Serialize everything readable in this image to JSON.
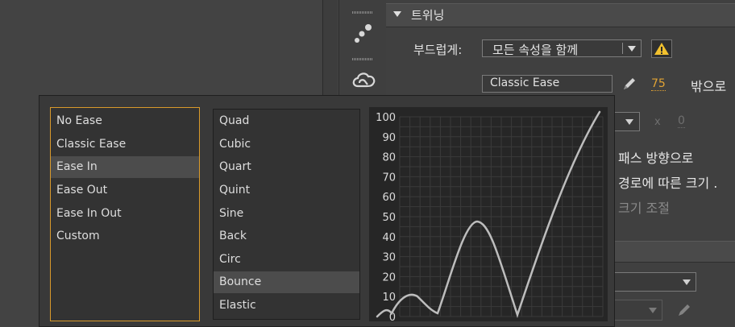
{
  "tween_panel": {
    "section_title": "트위닝",
    "smooth_label": "부드럽게:",
    "smooth_value": "모든 속성을 함께",
    "ease_value": "Classic Ease",
    "ease_amount": "75",
    "outside_label": "밖으로",
    "multiplier": "x",
    "zero_value": "0",
    "path_direction": "패스 방향으로",
    "path_size": "경로에 따른 크기 .",
    "scale_adjust": "크기 조절",
    "warning_color": "#f2c12e"
  },
  "ease_types": [
    {
      "label": "No Ease",
      "selected": false
    },
    {
      "label": "Classic Ease",
      "selected": false
    },
    {
      "label": "Ease In",
      "selected": true
    },
    {
      "label": "Ease Out",
      "selected": false
    },
    {
      "label": "Ease In Out",
      "selected": false
    },
    {
      "label": "Custom",
      "selected": false
    }
  ],
  "ease_presets": [
    {
      "label": "Quad",
      "selected": false
    },
    {
      "label": "Cubic",
      "selected": false
    },
    {
      "label": "Quart",
      "selected": false
    },
    {
      "label": "Quint",
      "selected": false
    },
    {
      "label": "Sine",
      "selected": false
    },
    {
      "label": "Back",
      "selected": false
    },
    {
      "label": "Circ",
      "selected": false
    },
    {
      "label": "Bounce",
      "selected": true
    },
    {
      "label": "Elastic",
      "selected": false
    }
  ],
  "graph": {
    "y_ticks": [
      "100",
      "90",
      "80",
      "70",
      "60",
      "50",
      "40",
      "30",
      "20",
      "10",
      "0"
    ],
    "curve": "Bounce Ease In"
  }
}
